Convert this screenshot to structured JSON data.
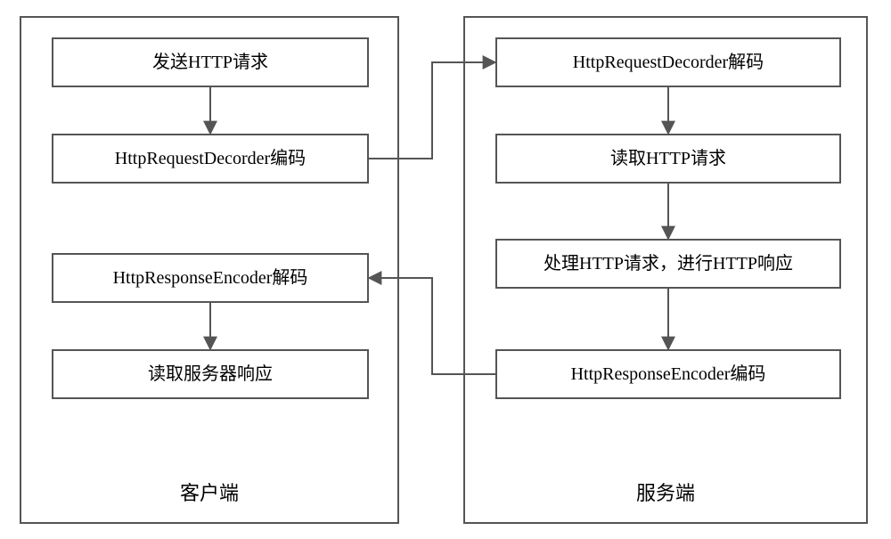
{
  "diagram": {
    "client": {
      "label": "客户端",
      "nodes": {
        "send_request": "发送HTTP请求",
        "request_encode": "HttpRequestDecorder编码",
        "response_decode": "HttpResponseEncoder解码",
        "read_response": "读取服务器响应"
      }
    },
    "server": {
      "label": "服务端",
      "nodes": {
        "request_decode": "HttpRequestDecorder解码",
        "read_request": "读取HTTP请求",
        "handle_request": "处理HTTP请求，进行HTTP响应",
        "response_encode": "HttpResponseEncoder编码"
      }
    }
  }
}
